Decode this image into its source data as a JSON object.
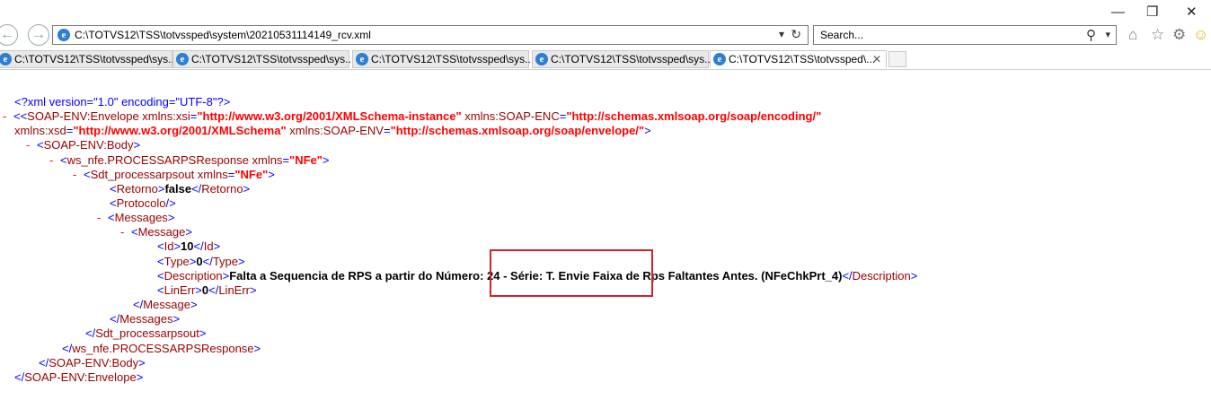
{
  "window": {
    "minimize": "—",
    "maximize": "❐",
    "close": "✕"
  },
  "address_bar": {
    "url": "C:\\TOTVS12\\TSS\\totvssped\\system\\20210531114149_rcv.xml",
    "dropdown": "▾",
    "refresh": "↻"
  },
  "search_bar": {
    "placeholder": "Search...",
    "search_icon": "⚲",
    "dropdown": "▾"
  },
  "toolbar": {
    "home": "⌂",
    "favorites": "☆",
    "settings": "⚙",
    "smiley": "☺"
  },
  "tabs": [
    {
      "label": "C:\\TOTVS12\\TSS\\totvssped\\sys..."
    },
    {
      "label": "C:\\TOTVS12\\TSS\\totvssped\\sys..."
    },
    {
      "label": "C:\\TOTVS12\\TSS\\totvssped\\sys..."
    },
    {
      "label": "C:\\TOTVS12\\TSS\\totvssped\\sys..."
    },
    {
      "label": "C:\\TOTVS12\\TSS\\totvssped\\...",
      "close": "✕"
    }
  ],
  "xml": {
    "pi": "<?xml version=\"1.0\" encoding=\"UTF-8\"?>",
    "env_open_a": "<SOAP-ENV:Envelope xmlns:xsi=",
    "env_xsi": "\"http://www.w3.org/2001/XMLSchema-instance\"",
    "env_enc_attr": " xmlns:SOAP-ENC=",
    "env_enc": "\"http://schemas.xmlsoap.org/soap/encoding/\"",
    "env_xsd_attr": "xmlns:xsd=",
    "env_xsd": "\"http://www.w3.org/2001/XMLSchema\"",
    "env_env_attr": " xmlns:SOAP-ENV=",
    "env_env": "\"http://schemas.xmlsoap.org/soap/envelope/\"",
    "env_close_bracket": ">",
    "body_open": "<SOAP-ENV:Body>",
    "resp_open": "<ws_nfe.PROCESSARPSResponse xmlns=",
    "resp_ns": "\"NFe\"",
    "sdt_open": "<Sdt_processarpsout xmlns=",
    "sdt_ns": "\"NFe\"",
    "retorno_open": "<Retorno>",
    "retorno_value": "false",
    "retorno_close": "</Retorno>",
    "protocolo": "<Protocolo/>",
    "messages_open": "<Messages>",
    "message_open": "<Message>",
    "id_open": "<Id>",
    "id_value": "10",
    "id_close": "</Id>",
    "type_open": "<Type>",
    "type_value": "0",
    "type_close": "</Type>",
    "desc_open": "<Description>",
    "desc_value": "Falta a Sequencia de RPS a partir do Número: 24 - Série: T. Envie Faixa de Rps Faltantes Antes. (NFeChkPrt_4)",
    "desc_close": "</Description>",
    "linerr_open": "<LinErr>",
    "linerr_value": "0",
    "linerr_close": "</LinErr>",
    "message_close": "</Message>",
    "messages_close": "</Messages>",
    "sdt_close": "</Sdt_processarpsout>",
    "resp_close": "</ws_nfe.PROCESSARPSResponse>",
    "body_close": "</SOAP-ENV:Body>",
    "env_close": "</SOAP-ENV:Envelope>",
    "minus": "-"
  },
  "colors": {
    "tag": "#990000",
    "punct": "#0000ff",
    "attr_value": "#ff0000",
    "highlight": "#d0232a"
  }
}
